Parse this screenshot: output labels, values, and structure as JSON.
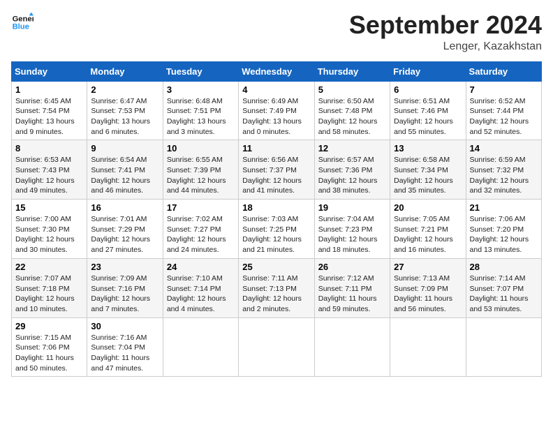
{
  "logo": {
    "line1": "General",
    "line2": "Blue"
  },
  "title": "September 2024",
  "location": "Lenger, Kazakhstan",
  "days_of_week": [
    "Sunday",
    "Monday",
    "Tuesday",
    "Wednesday",
    "Thursday",
    "Friday",
    "Saturday"
  ],
  "weeks": [
    [
      {
        "num": "1",
        "sunrise": "6:45 AM",
        "sunset": "7:54 PM",
        "daylight": "13 hours and 9 minutes."
      },
      {
        "num": "2",
        "sunrise": "6:47 AM",
        "sunset": "7:53 PM",
        "daylight": "13 hours and 6 minutes."
      },
      {
        "num": "3",
        "sunrise": "6:48 AM",
        "sunset": "7:51 PM",
        "daylight": "13 hours and 3 minutes."
      },
      {
        "num": "4",
        "sunrise": "6:49 AM",
        "sunset": "7:49 PM",
        "daylight": "13 hours and 0 minutes."
      },
      {
        "num": "5",
        "sunrise": "6:50 AM",
        "sunset": "7:48 PM",
        "daylight": "12 hours and 58 minutes."
      },
      {
        "num": "6",
        "sunrise": "6:51 AM",
        "sunset": "7:46 PM",
        "daylight": "12 hours and 55 minutes."
      },
      {
        "num": "7",
        "sunrise": "6:52 AM",
        "sunset": "7:44 PM",
        "daylight": "12 hours and 52 minutes."
      }
    ],
    [
      {
        "num": "8",
        "sunrise": "6:53 AM",
        "sunset": "7:43 PM",
        "daylight": "12 hours and 49 minutes."
      },
      {
        "num": "9",
        "sunrise": "6:54 AM",
        "sunset": "7:41 PM",
        "daylight": "12 hours and 46 minutes."
      },
      {
        "num": "10",
        "sunrise": "6:55 AM",
        "sunset": "7:39 PM",
        "daylight": "12 hours and 44 minutes."
      },
      {
        "num": "11",
        "sunrise": "6:56 AM",
        "sunset": "7:37 PM",
        "daylight": "12 hours and 41 minutes."
      },
      {
        "num": "12",
        "sunrise": "6:57 AM",
        "sunset": "7:36 PM",
        "daylight": "12 hours and 38 minutes."
      },
      {
        "num": "13",
        "sunrise": "6:58 AM",
        "sunset": "7:34 PM",
        "daylight": "12 hours and 35 minutes."
      },
      {
        "num": "14",
        "sunrise": "6:59 AM",
        "sunset": "7:32 PM",
        "daylight": "12 hours and 32 minutes."
      }
    ],
    [
      {
        "num": "15",
        "sunrise": "7:00 AM",
        "sunset": "7:30 PM",
        "daylight": "12 hours and 30 minutes."
      },
      {
        "num": "16",
        "sunrise": "7:01 AM",
        "sunset": "7:29 PM",
        "daylight": "12 hours and 27 minutes."
      },
      {
        "num": "17",
        "sunrise": "7:02 AM",
        "sunset": "7:27 PM",
        "daylight": "12 hours and 24 minutes."
      },
      {
        "num": "18",
        "sunrise": "7:03 AM",
        "sunset": "7:25 PM",
        "daylight": "12 hours and 21 minutes."
      },
      {
        "num": "19",
        "sunrise": "7:04 AM",
        "sunset": "7:23 PM",
        "daylight": "12 hours and 18 minutes."
      },
      {
        "num": "20",
        "sunrise": "7:05 AM",
        "sunset": "7:21 PM",
        "daylight": "12 hours and 16 minutes."
      },
      {
        "num": "21",
        "sunrise": "7:06 AM",
        "sunset": "7:20 PM",
        "daylight": "12 hours and 13 minutes."
      }
    ],
    [
      {
        "num": "22",
        "sunrise": "7:07 AM",
        "sunset": "7:18 PM",
        "daylight": "12 hours and 10 minutes."
      },
      {
        "num": "23",
        "sunrise": "7:09 AM",
        "sunset": "7:16 PM",
        "daylight": "12 hours and 7 minutes."
      },
      {
        "num": "24",
        "sunrise": "7:10 AM",
        "sunset": "7:14 PM",
        "daylight": "12 hours and 4 minutes."
      },
      {
        "num": "25",
        "sunrise": "7:11 AM",
        "sunset": "7:13 PM",
        "daylight": "12 hours and 2 minutes."
      },
      {
        "num": "26",
        "sunrise": "7:12 AM",
        "sunset": "7:11 PM",
        "daylight": "11 hours and 59 minutes."
      },
      {
        "num": "27",
        "sunrise": "7:13 AM",
        "sunset": "7:09 PM",
        "daylight": "11 hours and 56 minutes."
      },
      {
        "num": "28",
        "sunrise": "7:14 AM",
        "sunset": "7:07 PM",
        "daylight": "11 hours and 53 minutes."
      }
    ],
    [
      {
        "num": "29",
        "sunrise": "7:15 AM",
        "sunset": "7:06 PM",
        "daylight": "11 hours and 50 minutes."
      },
      {
        "num": "30",
        "sunrise": "7:16 AM",
        "sunset": "7:04 PM",
        "daylight": "11 hours and 47 minutes."
      },
      null,
      null,
      null,
      null,
      null
    ]
  ]
}
